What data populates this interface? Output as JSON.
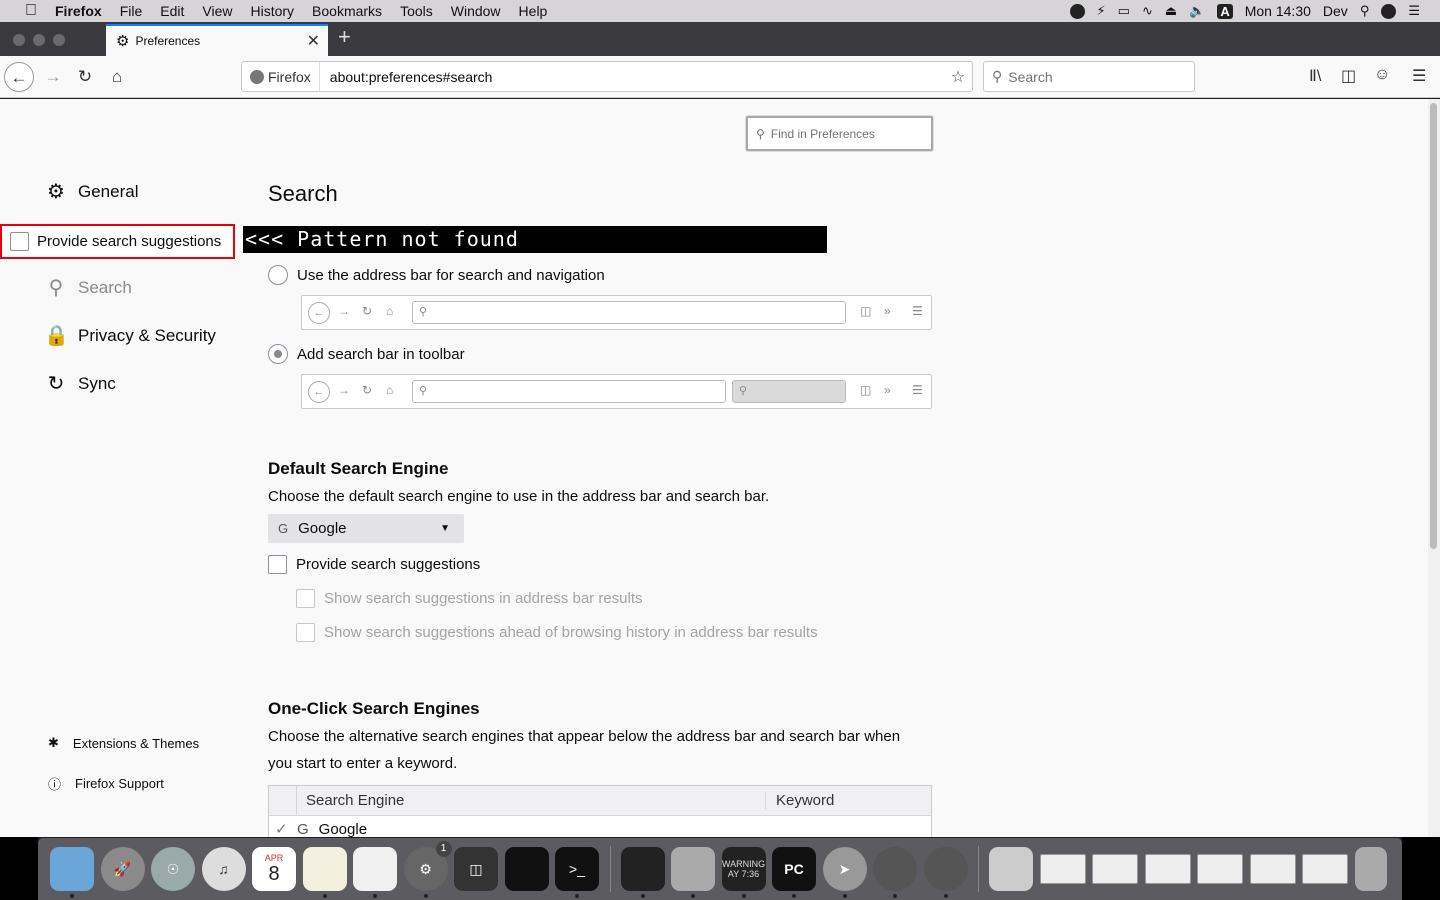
{
  "menubar": {
    "app": "Firefox",
    "items": [
      "File",
      "Edit",
      "View",
      "History",
      "Bookmarks",
      "Tools",
      "Window",
      "Help"
    ],
    "clock": "Mon 14:30",
    "user": "Dev"
  },
  "tab": {
    "title": "Preferences"
  },
  "navbar": {
    "identity": "Firefox",
    "url": "about:preferences#search",
    "search_placeholder": "Search"
  },
  "prefs": {
    "find_placeholder": "Find in Preferences",
    "categories": [
      "General",
      "Search",
      "Privacy & Security",
      "Sync"
    ],
    "footer": [
      "Extensions & Themes",
      "Firefox Support"
    ],
    "highlight_label": "Provide search suggestions",
    "banner": "<<< Pattern not found",
    "title": "Search",
    "radio1": "Use the address bar for search and navigation",
    "radio2": "Add search bar in toolbar",
    "default_engine_heading": "Default Search Engine",
    "default_engine_desc": "Choose the default search engine to use in the address bar and search bar.",
    "default_engine_value": "Google",
    "suggest_label": "Provide search suggestions",
    "suggest_sub1": "Show search suggestions in address bar results",
    "suggest_sub2": "Show search suggestions ahead of browsing history in address bar results",
    "oneclick_heading": "One-Click Search Engines",
    "oneclick_desc1": "Choose the alternative search engines that appear below the address bar and search bar when",
    "oneclick_desc2": "you start to enter a keyword.",
    "table_headers": [
      "Search Engine",
      "Keyword"
    ],
    "table_rows": [
      {
        "name": "Google",
        "keyword": ""
      }
    ]
  },
  "dock": {
    "calendar_month": "APR",
    "calendar_day": "8",
    "sysprefs_badge": "1",
    "console_text": "WARNING\nAY 7:36",
    "pycharm": "PC"
  }
}
